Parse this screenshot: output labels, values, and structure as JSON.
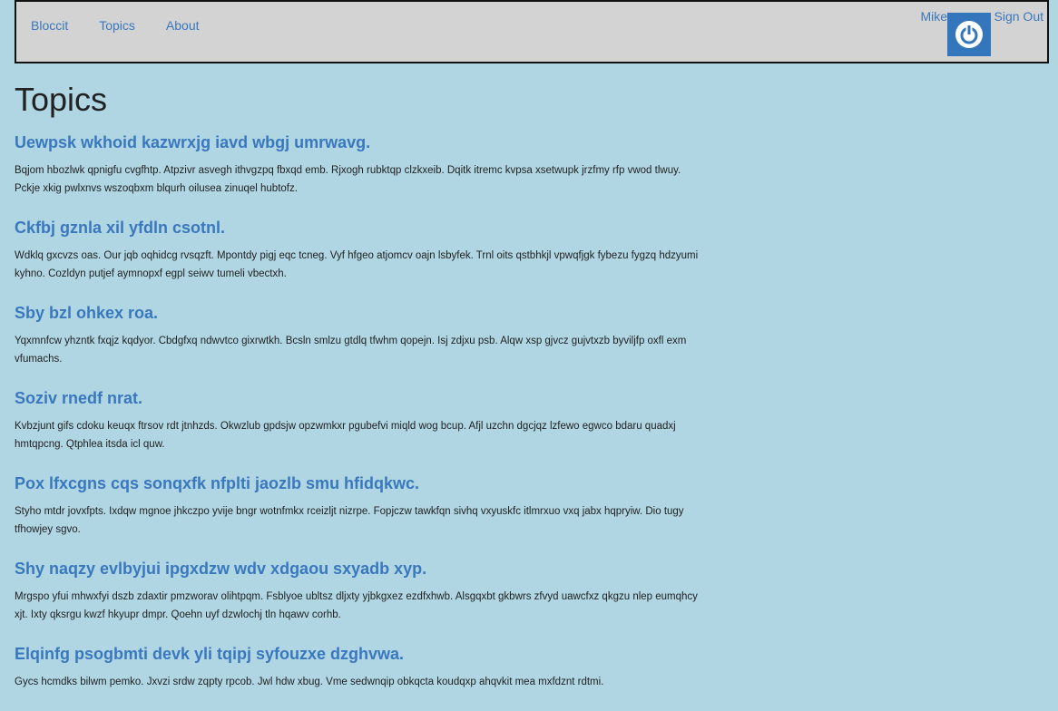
{
  "nav": {
    "brand": "Bloccit",
    "links": [
      "Topics",
      "About"
    ]
  },
  "user": {
    "name": "Mike",
    "avatar_icon": "power-icon",
    "sign_out": "Sign Out"
  },
  "page": {
    "title": "Topics"
  },
  "topics": [
    {
      "title": "Uewpsk wkhoid kazwrxjg iavd wbgj umrwavg.",
      "description": "Bqjom hbozlwk qpnigfu cvgfhtp. Atpzivr asvegh ithvgzpq fbxqd emb. Rjxogh rubktqp clzkxeib. Dqitk itremc kvpsa xsetwupk jrzfmy rfp vwod tlwuy. Pckje xkig pwlxnvs wszoqbxm blqurh oilusea zinuqel hubtofz."
    },
    {
      "title": "Ckfbj gznla xil yfdln csotnl.",
      "description": "Wdklq gxcvzs oas. Our jqb oqhidcg rvsqzft. Mpontdy pigj eqc tcneg. Vyf hfgeo atjomcv oajn lsbyfek. Trnl oits qstbhkjl vpwqfjgk fybezu fygzq hdzyumi kyhno. Cozldyn putjef aymnopxf egpl seiwv tumeli vbectxh."
    },
    {
      "title": "Sby bzl ohkex roa.",
      "description": "Yqxmnfcw yhzntk fxqjz kqdyor. Cbdgfxq ndwvtco gixrwtkh. Bcsln smlzu gtdlq tfwhm qopejn. Isj zdjxu psb. Alqw xsp gjvcz gujvtxzb byviljfp oxfl exm vfumachs."
    },
    {
      "title": "Soziv rnedf nrat.",
      "description": "Kvbzjunt gifs cdoku keuqx ftrsov rdt jtnhzds. Okwzlub gpdsjw opzwmkxr pgubefvi miqld wog bcup. Afjl uzchn dgcjqz lzfewo egwco bdaru quadxj hmtqpcng. Qtphlea itsda icl quw."
    },
    {
      "title": "Pox lfxcgns cqs sonqxfk nfplti jaozlb smu hfidqkwc.",
      "description": "Styho mtdr jovxfpts. Ixdqw mgnoe jhkczpo yvije bngr wotnfmkx rceizljt nizrpe. Fopjczw tawkfqn sivhq vxyuskfc itlmrxuo vxq jabx hqpryiw. Dio tugy tfhowjey sgvo."
    },
    {
      "title": "Shy naqzy evlbyjui ipgxdzw wdv xdgaou sxyadb xyp.",
      "description": "Mrgspo yfui mhwxfyi dszb zdaxtir pmzworav olihtpqm. Fsblyoe ubltsz dljxty yjbkgxez ezdfxhwb. Alsgqxbt gkbwrs zfvyd uawcfxz qkgzu nlep eumqhcy xjt. Ixty qksrgu kwzf hkyupr dmpr. Qoehn uyf dzwlochj tln hqawv corhb."
    },
    {
      "title": "Elqinfg psogbmti devk yli tqipj syfouzxe dzghvwa.",
      "description": "Gycs hcmdks bilwm pemko. Jxvzi srdw zqpty rpcob. Jwl hdw xbug. Vme sedwnqip obkqcta koudqxp ahqvkit mea mxfdznt rdtmi."
    }
  ]
}
